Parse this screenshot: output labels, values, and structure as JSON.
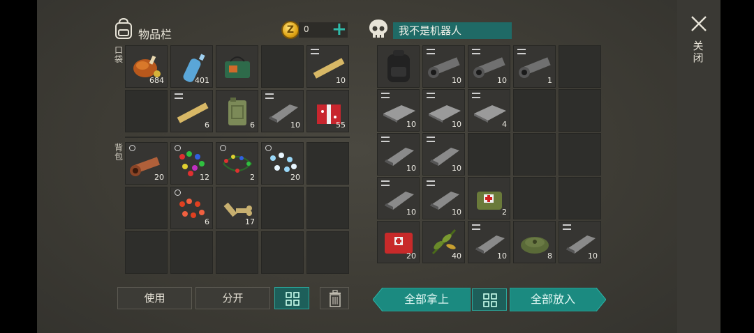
{
  "inventory": {
    "title": "物品栏",
    "coins": "0",
    "coin_symbol": "Z",
    "pocket_label": "口袋",
    "backpack_label": "背包",
    "pocket_slots": [
      {
        "item": "roast-chicken",
        "count": "684"
      },
      {
        "item": "water-bottle",
        "count": "401"
      },
      {
        "item": "green-toolbox",
        "count": ""
      },
      {
        "item": "empty",
        "count": ""
      },
      {
        "item": "wood-plank",
        "count": "10"
      },
      {
        "item": "empty",
        "count": ""
      },
      {
        "item": "wood-plank",
        "count": "6"
      },
      {
        "item": "jerrycan",
        "count": "6"
      },
      {
        "item": "metal-ingot",
        "count": "10"
      },
      {
        "item": "gift-box",
        "count": "55"
      }
    ],
    "backpack_slots": [
      {
        "item": "copper-pipe",
        "count": "20"
      },
      {
        "item": "christmas-lights",
        "count": "12"
      },
      {
        "item": "christmas-lights-2",
        "count": "2"
      },
      {
        "item": "christmas-lights-blue",
        "count": "20"
      },
      {
        "item": "empty",
        "count": ""
      },
      {
        "item": "empty",
        "count": ""
      },
      {
        "item": "red-lights",
        "count": "6"
      },
      {
        "item": "dog-bone",
        "count": "17"
      },
      {
        "item": "empty",
        "count": ""
      },
      {
        "item": "empty",
        "count": ""
      },
      {
        "item": "empty",
        "count": ""
      },
      {
        "item": "empty",
        "count": ""
      },
      {
        "item": "empty",
        "count": ""
      },
      {
        "item": "empty",
        "count": ""
      },
      {
        "item": "empty",
        "count": ""
      }
    ]
  },
  "container": {
    "owner_name": "我不是机器人",
    "slots": [
      {
        "item": "backpack",
        "count": ""
      },
      {
        "item": "steel-pipe",
        "count": "10"
      },
      {
        "item": "steel-pipe",
        "count": "10"
      },
      {
        "item": "steel-pipe",
        "count": "1"
      },
      {
        "item": "empty",
        "count": ""
      },
      {
        "item": "metal-sheet",
        "count": "10"
      },
      {
        "item": "metal-sheet",
        "count": "10"
      },
      {
        "item": "metal-sheet",
        "count": "4"
      },
      {
        "item": "empty",
        "count": ""
      },
      {
        "item": "empty",
        "count": ""
      },
      {
        "item": "metal-ingot",
        "count": "10"
      },
      {
        "item": "metal-ingot",
        "count": "10"
      },
      {
        "item": "empty",
        "count": ""
      },
      {
        "item": "empty",
        "count": ""
      },
      {
        "item": "empty",
        "count": ""
      },
      {
        "item": "metal-ingot",
        "count": "10"
      },
      {
        "item": "metal-ingot",
        "count": "10"
      },
      {
        "item": "medic-bag",
        "count": "2"
      },
      {
        "item": "empty",
        "count": ""
      },
      {
        "item": "empty",
        "count": ""
      },
      {
        "item": "first-aid-kit",
        "count": "20"
      },
      {
        "item": "herb",
        "count": "40"
      },
      {
        "item": "metal-ingot",
        "count": "10"
      },
      {
        "item": "landmine",
        "count": "8"
      },
      {
        "item": "metal-ingot",
        "count": "10"
      }
    ]
  },
  "buttons": {
    "use": "使用",
    "split": "分开",
    "take_all": "全部拿上",
    "put_all": "全部放入"
  },
  "close": {
    "label": "关闭"
  },
  "colors": {
    "accent": "#1b8a80",
    "name_box": "#1f6a66",
    "coin": "#e0a516"
  }
}
